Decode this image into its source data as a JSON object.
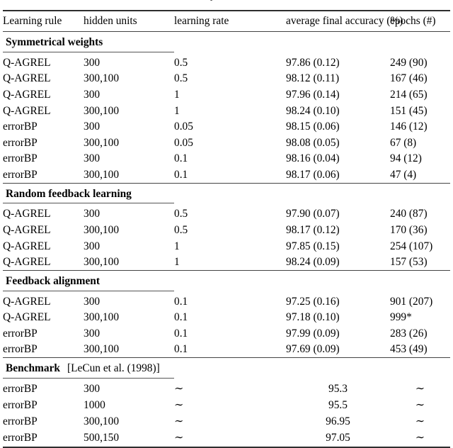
{
  "caption_remnant": "experiments",
  "table": {
    "columns": [
      {
        "key": "learning_rule",
        "label": "Learning rule"
      },
      {
        "key": "hidden_units",
        "label": "hidden units"
      },
      {
        "key": "learning_rate",
        "label": "learning rate"
      },
      {
        "key": "average_final_accuracy",
        "label": "average final accuracy (%)"
      },
      {
        "key": "epochs",
        "label": "epochs (#)"
      }
    ],
    "sections": [
      {
        "title": "Symmetrical weights",
        "citation": "",
        "rows": [
          {
            "learning_rule": "Q-AGREL",
            "hidden_units": "300",
            "learning_rate": "0.5",
            "average_final_accuracy": "97.86 (0.12)",
            "epochs": "249 (90)"
          },
          {
            "learning_rule": "Q-AGREL",
            "hidden_units": "300,100",
            "learning_rate": "0.5",
            "average_final_accuracy": "98.12 (0.11)",
            "epochs": "167 (46)"
          },
          {
            "learning_rule": "Q-AGREL",
            "hidden_units": "300",
            "learning_rate": "1",
            "average_final_accuracy": "97.96 (0.14)",
            "epochs": "214 (65)"
          },
          {
            "learning_rule": "Q-AGREL",
            "hidden_units": "300,100",
            "learning_rate": "1",
            "average_final_accuracy": "98.24 (0.10)",
            "epochs": "151 (45)"
          },
          {
            "learning_rule": "errorBP",
            "hidden_units": "300",
            "learning_rate": "0.05",
            "average_final_accuracy": "98.15 (0.06)",
            "epochs": "146 (12)"
          },
          {
            "learning_rule": "errorBP",
            "hidden_units": "300,100",
            "learning_rate": "0.05",
            "average_final_accuracy": "98.08 (0.05)",
            "epochs": "67 (8)"
          },
          {
            "learning_rule": "errorBP",
            "hidden_units": "300",
            "learning_rate": "0.1",
            "average_final_accuracy": "98.16 (0.04)",
            "epochs": "94 (12)"
          },
          {
            "learning_rule": "errorBP",
            "hidden_units": "300,100",
            "learning_rate": "0.1",
            "average_final_accuracy": "98.17 (0.06)",
            "epochs": "47 (4)"
          }
        ]
      },
      {
        "title": "Random feedback learning",
        "citation": "",
        "rows": [
          {
            "learning_rule": "Q-AGREL",
            "hidden_units": "300",
            "learning_rate": "0.5",
            "average_final_accuracy": "97.90 (0.07)",
            "epochs": "240 (87)"
          },
          {
            "learning_rule": "Q-AGREL",
            "hidden_units": "300,100",
            "learning_rate": "0.5",
            "average_final_accuracy": "98.17 (0.12)",
            "epochs": "170 (36)"
          },
          {
            "learning_rule": "Q-AGREL",
            "hidden_units": "300",
            "learning_rate": "1",
            "average_final_accuracy": "97.85 (0.15)",
            "epochs": "254 (107)"
          },
          {
            "learning_rule": "Q-AGREL",
            "hidden_units": "300,100",
            "learning_rate": "1",
            "average_final_accuracy": "98.24 (0.09)",
            "epochs": "157 (53)"
          }
        ]
      },
      {
        "title": "Feedback alignment",
        "citation": "",
        "rows": [
          {
            "learning_rule": "Q-AGREL",
            "hidden_units": "300",
            "learning_rate": "0.1",
            "average_final_accuracy": "97.25 (0.16)",
            "epochs": "901 (207)"
          },
          {
            "learning_rule": "Q-AGREL",
            "hidden_units": "300,100",
            "learning_rate": "0.1",
            "average_final_accuracy": "97.18 (0.10)",
            "epochs": "999*"
          },
          {
            "learning_rule": "errorBP",
            "hidden_units": "300",
            "learning_rate": "0.1",
            "average_final_accuracy": "97.99 (0.09)",
            "epochs": "283 (26)"
          },
          {
            "learning_rule": "errorBP",
            "hidden_units": "300,100",
            "learning_rate": "0.1",
            "average_final_accuracy": "97.69 (0.09)",
            "epochs": "453 (49)"
          }
        ]
      },
      {
        "title": "Benchmark",
        "citation": "[LeCun et al. (1998)]",
        "centered_values": true,
        "rows": [
          {
            "learning_rule": "errorBP",
            "hidden_units": "300",
            "learning_rate": "∼",
            "average_final_accuracy": "95.3",
            "epochs": "∼"
          },
          {
            "learning_rule": "errorBP",
            "hidden_units": "1000",
            "learning_rate": "∼",
            "average_final_accuracy": "95.5",
            "epochs": "∼"
          },
          {
            "learning_rule": "errorBP",
            "hidden_units": "300,100",
            "learning_rate": "∼",
            "average_final_accuracy": "96.95",
            "epochs": "∼"
          },
          {
            "learning_rule": "errorBP",
            "hidden_units": "500,150",
            "learning_rate": "∼",
            "average_final_accuracy": "97.05",
            "epochs": "∼"
          }
        ]
      }
    ]
  }
}
